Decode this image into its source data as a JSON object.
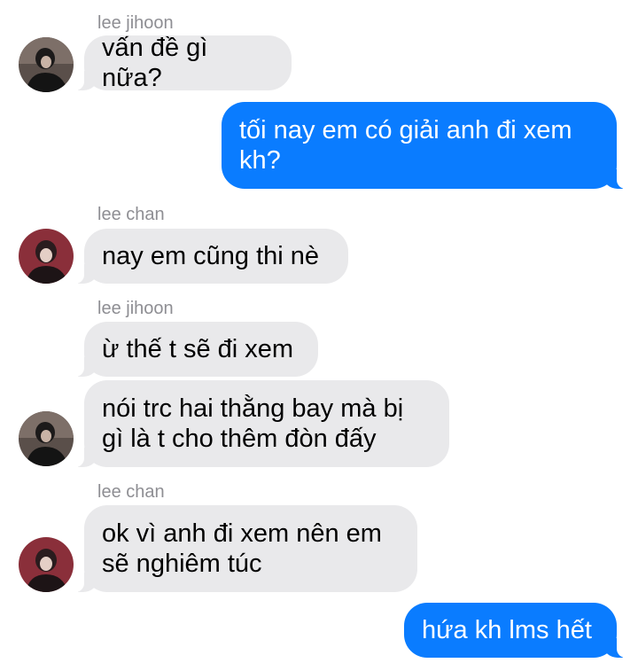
{
  "messages": [
    {
      "sender": "lee jihoon",
      "text": "vấn đề gì nữa?"
    },
    {
      "text_line1": "tối nay em có giải anh đi xem",
      "text_line2": "kh?"
    },
    {
      "sender": "lee chan",
      "text": "nay em cũng thi nè"
    },
    {
      "sender": "lee jihoon",
      "text": "ừ thế t sẽ đi xem"
    },
    {
      "text_line1": "nói trc hai thằng bay mà bị",
      "text_line2": "gì là t cho thêm đòn đấy"
    },
    {
      "sender": "lee chan",
      "text_line1": "ok vì anh đi xem nên em",
      "text_line2": "sẽ nghiêm túc"
    },
    {
      "text": "hứa kh lms hết"
    }
  ],
  "colors": {
    "incoming_bubble": "#e9e9eb",
    "outgoing_bubble": "#0a7cff",
    "sender_name": "#8e8e93"
  }
}
